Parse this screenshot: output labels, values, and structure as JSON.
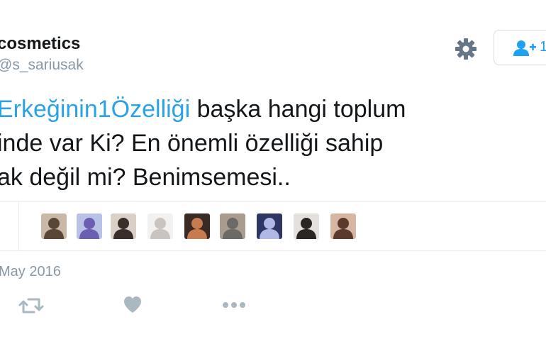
{
  "profile": {
    "display_name": "cosmetics",
    "handle": "@s_sariusak"
  },
  "header_actions": {
    "gear_icon": "gear-icon",
    "follow_icon": "follow-user-icon",
    "follow_count": "1"
  },
  "tweet": {
    "line1_hashtag": "Erkeğinin1Özelliği",
    "line1_rest": " başka hangi toplum",
    "line2": "inde var Ki? En önemli özelliği sahip",
    "line3": "ak değil mi? Benimsemesi.."
  },
  "likers": {
    "avatars": [
      {
        "name": "liker-avatar-1",
        "bg": "#c9b8a6",
        "fg": "#5a4636"
      },
      {
        "name": "liker-avatar-2",
        "bg": "#b8c2e6",
        "fg": "#6a5fb0"
      },
      {
        "name": "liker-avatar-3",
        "bg": "#d9d0c8",
        "fg": "#3a2e2a"
      },
      {
        "name": "liker-avatar-4",
        "bg": "#f3f1ef",
        "fg": "#c9c4bf"
      },
      {
        "name": "liker-avatar-5",
        "bg": "#3a2a24",
        "fg": "#c67c4e"
      },
      {
        "name": "liker-avatar-6",
        "bg": "#a99b8d",
        "fg": "#6d6a66"
      },
      {
        "name": "liker-avatar-7",
        "bg": "#2e3763",
        "fg": "#b0b9e3"
      },
      {
        "name": "liker-avatar-8",
        "bg": "#e4e0dc",
        "fg": "#2a2624"
      },
      {
        "name": "liker-avatar-9",
        "bg": "#d6b5a3",
        "fg": "#5b3a2e"
      }
    ]
  },
  "meta": {
    "date": "May 2016"
  },
  "actions": {
    "retweet_icon": "retweet-icon",
    "like_icon": "heart-icon",
    "more_icon": "more-icon"
  },
  "colors": {
    "hashtag": "#2aa3e6",
    "muted": "#8899a6",
    "icon": "#657786",
    "action_icon": "#aab8c2",
    "follow_blue": "#1da1f2"
  }
}
